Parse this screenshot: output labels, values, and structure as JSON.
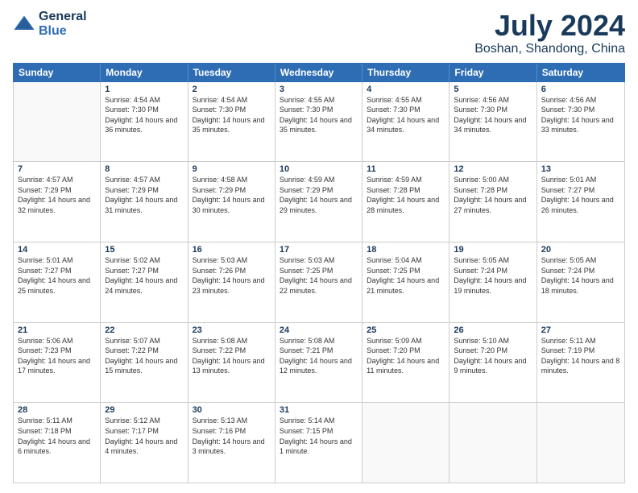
{
  "header": {
    "logo": {
      "line1": "General",
      "line2": "Blue"
    },
    "title": "July 2024",
    "subtitle": "Boshan, Shandong, China"
  },
  "weekdays": [
    "Sunday",
    "Monday",
    "Tuesday",
    "Wednesday",
    "Thursday",
    "Friday",
    "Saturday"
  ],
  "weeks": [
    [
      {
        "day": "",
        "empty": true
      },
      {
        "day": "1",
        "sunrise": "4:54 AM",
        "sunset": "7:30 PM",
        "daylight": "14 hours and 36 minutes."
      },
      {
        "day": "2",
        "sunrise": "4:54 AM",
        "sunset": "7:30 PM",
        "daylight": "14 hours and 35 minutes."
      },
      {
        "day": "3",
        "sunrise": "4:55 AM",
        "sunset": "7:30 PM",
        "daylight": "14 hours and 35 minutes."
      },
      {
        "day": "4",
        "sunrise": "4:55 AM",
        "sunset": "7:30 PM",
        "daylight": "14 hours and 34 minutes."
      },
      {
        "day": "5",
        "sunrise": "4:56 AM",
        "sunset": "7:30 PM",
        "daylight": "14 hours and 34 minutes."
      },
      {
        "day": "6",
        "sunrise": "4:56 AM",
        "sunset": "7:30 PM",
        "daylight": "14 hours and 33 minutes."
      }
    ],
    [
      {
        "day": "7",
        "sunrise": "4:57 AM",
        "sunset": "7:29 PM",
        "daylight": "14 hours and 32 minutes."
      },
      {
        "day": "8",
        "sunrise": "4:57 AM",
        "sunset": "7:29 PM",
        "daylight": "14 hours and 31 minutes."
      },
      {
        "day": "9",
        "sunrise": "4:58 AM",
        "sunset": "7:29 PM",
        "daylight": "14 hours and 30 minutes."
      },
      {
        "day": "10",
        "sunrise": "4:59 AM",
        "sunset": "7:29 PM",
        "daylight": "14 hours and 29 minutes."
      },
      {
        "day": "11",
        "sunrise": "4:59 AM",
        "sunset": "7:28 PM",
        "daylight": "14 hours and 28 minutes."
      },
      {
        "day": "12",
        "sunrise": "5:00 AM",
        "sunset": "7:28 PM",
        "daylight": "14 hours and 27 minutes."
      },
      {
        "day": "13",
        "sunrise": "5:01 AM",
        "sunset": "7:27 PM",
        "daylight": "14 hours and 26 minutes."
      }
    ],
    [
      {
        "day": "14",
        "sunrise": "5:01 AM",
        "sunset": "7:27 PM",
        "daylight": "14 hours and 25 minutes."
      },
      {
        "day": "15",
        "sunrise": "5:02 AM",
        "sunset": "7:27 PM",
        "daylight": "14 hours and 24 minutes."
      },
      {
        "day": "16",
        "sunrise": "5:03 AM",
        "sunset": "7:26 PM",
        "daylight": "14 hours and 23 minutes."
      },
      {
        "day": "17",
        "sunrise": "5:03 AM",
        "sunset": "7:25 PM",
        "daylight": "14 hours and 22 minutes."
      },
      {
        "day": "18",
        "sunrise": "5:04 AM",
        "sunset": "7:25 PM",
        "daylight": "14 hours and 21 minutes."
      },
      {
        "day": "19",
        "sunrise": "5:05 AM",
        "sunset": "7:24 PM",
        "daylight": "14 hours and 19 minutes."
      },
      {
        "day": "20",
        "sunrise": "5:05 AM",
        "sunset": "7:24 PM",
        "daylight": "14 hours and 18 minutes."
      }
    ],
    [
      {
        "day": "21",
        "sunrise": "5:06 AM",
        "sunset": "7:23 PM",
        "daylight": "14 hours and 17 minutes."
      },
      {
        "day": "22",
        "sunrise": "5:07 AM",
        "sunset": "7:22 PM",
        "daylight": "14 hours and 15 minutes."
      },
      {
        "day": "23",
        "sunrise": "5:08 AM",
        "sunset": "7:22 PM",
        "daylight": "14 hours and 13 minutes."
      },
      {
        "day": "24",
        "sunrise": "5:08 AM",
        "sunset": "7:21 PM",
        "daylight": "14 hours and 12 minutes."
      },
      {
        "day": "25",
        "sunrise": "5:09 AM",
        "sunset": "7:20 PM",
        "daylight": "14 hours and 11 minutes."
      },
      {
        "day": "26",
        "sunrise": "5:10 AM",
        "sunset": "7:20 PM",
        "daylight": "14 hours and 9 minutes."
      },
      {
        "day": "27",
        "sunrise": "5:11 AM",
        "sunset": "7:19 PM",
        "daylight": "14 hours and 8 minutes."
      }
    ],
    [
      {
        "day": "28",
        "sunrise": "5:11 AM",
        "sunset": "7:18 PM",
        "daylight": "14 hours and 6 minutes."
      },
      {
        "day": "29",
        "sunrise": "5:12 AM",
        "sunset": "7:17 PM",
        "daylight": "14 hours and 4 minutes."
      },
      {
        "day": "30",
        "sunrise": "5:13 AM",
        "sunset": "7:16 PM",
        "daylight": "14 hours and 3 minutes."
      },
      {
        "day": "31",
        "sunrise": "5:14 AM",
        "sunset": "7:15 PM",
        "daylight": "14 hours and 1 minute."
      },
      {
        "day": "",
        "empty": true
      },
      {
        "day": "",
        "empty": true
      },
      {
        "day": "",
        "empty": true
      }
    ]
  ]
}
